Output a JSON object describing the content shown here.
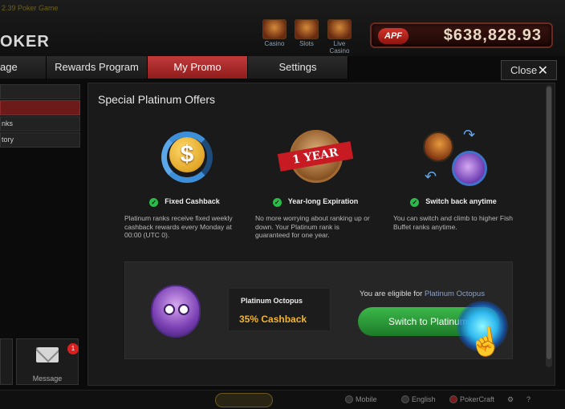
{
  "window": {
    "caption": "2.39 Poker Game",
    "logo": "OKER"
  },
  "games": [
    {
      "label": "Casino"
    },
    {
      "label": "Slots"
    },
    {
      "label": "Live Casino"
    }
  ],
  "balance": {
    "brand": "APF",
    "amount": "$638,828.93"
  },
  "tabs": [
    {
      "label": "age"
    },
    {
      "label": "Rewards Program"
    },
    {
      "label": "My Promo"
    },
    {
      "label": "Settings"
    }
  ],
  "close_label": "Close",
  "sidebar": {
    "items": [
      {
        "label": ""
      },
      {
        "label": ""
      },
      {
        "label": "nks"
      },
      {
        "label": "tory"
      }
    ],
    "message": {
      "label": "Message",
      "badge": "1"
    }
  },
  "panel": {
    "title": "Special Platinum Offers",
    "features": [
      {
        "icon": "dollar-coin-icon",
        "title": "Fixed Cashback",
        "description": "Platinum ranks receive fixed weekly cashback rewards every Monday at 00:00 (UTC 0)."
      },
      {
        "icon": "one-year-medal-icon",
        "badge_text": "1 YEAR",
        "title": "Year-long Expiration",
        "description": "No more worrying about ranking up or down. Your Platinum rank is guaranteed for one year."
      },
      {
        "icon": "switch-fish-icon",
        "title": "Switch back anytime",
        "description": "You can switch and climb to higher Fish Buffet ranks anytime."
      }
    ],
    "rank": {
      "name": "Platinum Octopus",
      "cashback": "35% Cashback",
      "eligible_prefix": "You are eligible for",
      "eligible_rank": "Platinum Octopus",
      "button_label": "Switch to Platinum"
    }
  },
  "statusbar": {
    "mobile": "Mobile",
    "language": "English",
    "brand": "PokerCraft"
  },
  "colors": {
    "accent_red": "#c23a3a",
    "button_green": "#3cb84a",
    "cashback_gold": "#f0b431",
    "check_green": "#2bbb4a"
  }
}
